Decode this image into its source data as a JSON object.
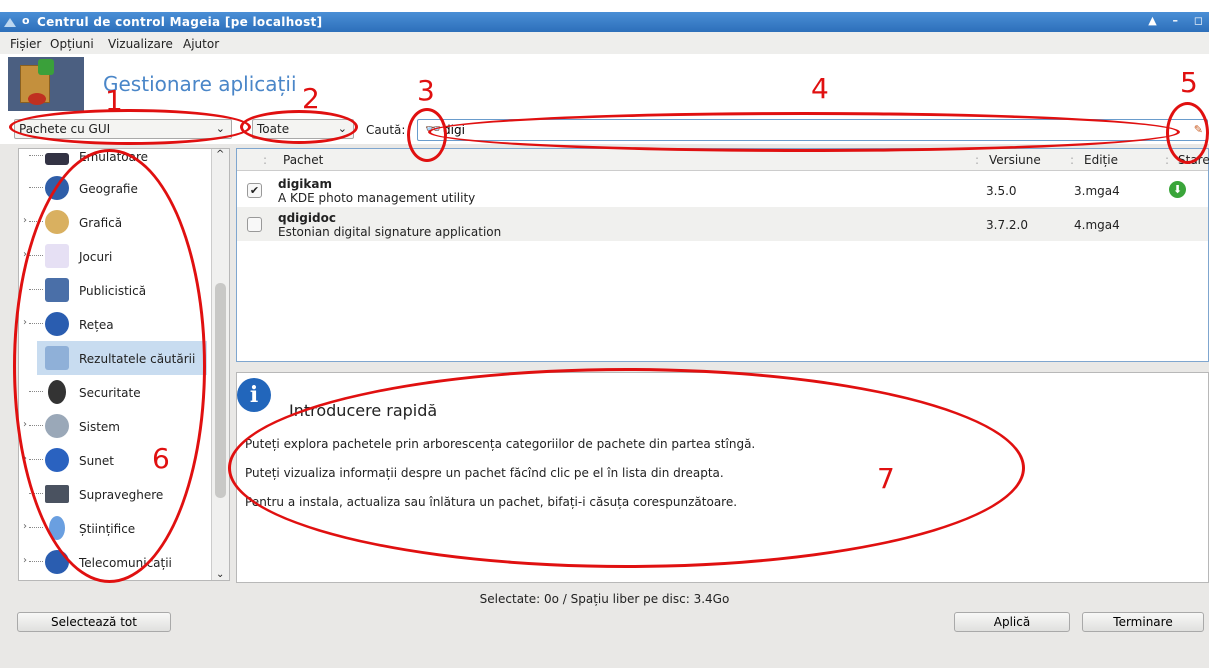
{
  "window": {
    "title": "Centrul de control Mageia  [pe localhost]",
    "controls": "▲ – ◻"
  },
  "menu": [
    "Fișier",
    "Opțiuni",
    "Vizualizare",
    "Ajutor"
  ],
  "header": {
    "title": "Gestionare aplicații"
  },
  "filters": {
    "package_type": "Pachete cu GUI",
    "status": "Toate",
    "search_label": "Caută:",
    "search_value": "digi"
  },
  "categories": [
    {
      "label": "Emulatoare",
      "icon": "emulator-icon",
      "expandable": false
    },
    {
      "label": "Geografie",
      "icon": "globe-icon",
      "expandable": false
    },
    {
      "label": "Grafică",
      "icon": "palette-icon",
      "expandable": true
    },
    {
      "label": "Jocuri",
      "icon": "cards-icon",
      "expandable": true
    },
    {
      "label": "Publicistică",
      "icon": "book-icon",
      "expandable": false
    },
    {
      "label": "Rețea",
      "icon": "network-globe-icon",
      "expandable": true
    },
    {
      "label": "Rezultatele căutării",
      "icon": "search-results-icon",
      "expandable": false,
      "selected": true
    },
    {
      "label": "Securitate",
      "icon": "bell-lock-icon",
      "expandable": false
    },
    {
      "label": "Sistem",
      "icon": "tools-icon",
      "expandable": true
    },
    {
      "label": "Sunet",
      "icon": "speaker-icon",
      "expandable": true
    },
    {
      "label": "Supraveghere",
      "icon": "monitor-icon",
      "expandable": false
    },
    {
      "label": "Științifice",
      "icon": "flask-icon",
      "expandable": true
    },
    {
      "label": "Telecomunicații",
      "icon": "phone-globe-icon",
      "expandable": true
    }
  ],
  "table": {
    "columns": [
      "Pachet",
      "Versiune",
      "Ediție",
      "Stare"
    ],
    "rows": [
      {
        "name": "digikam",
        "summary": "A KDE photo management utility",
        "version": "3.5.0",
        "edition": "3.mga4",
        "checked": true,
        "state": "install-arrow-icon"
      },
      {
        "name": "qdigidoc",
        "summary": "Estonian digital signature application",
        "version": "3.7.2.0",
        "edition": "4.mga4",
        "checked": false,
        "state": ""
      }
    ]
  },
  "info": {
    "heading": "Introducere rapidă",
    "paragraphs": [
      "Puteți explora pachetele prin arborescența categoriilor de pachete din partea stîngă.",
      "Puteți vizualiza informații despre un pachet făcînd clic pe el în lista din dreapta.",
      "Pentru a instala, actualiza sau înlătura un pachet, bifați-i căsuța corespunzătoare."
    ]
  },
  "status": "Selectate: 0o / Spațiu liber pe disc: 3.4Go",
  "buttons": {
    "select_all": "Selectează tot",
    "apply": "Aplică",
    "finish": "Terminare"
  },
  "annotations": [
    "1",
    "2",
    "3",
    "4",
    "5",
    "6",
    "7"
  ],
  "colors": {
    "annotation": "#e01010",
    "title_blue": "#4a86c8",
    "titlebar": "#2d6fba"
  }
}
